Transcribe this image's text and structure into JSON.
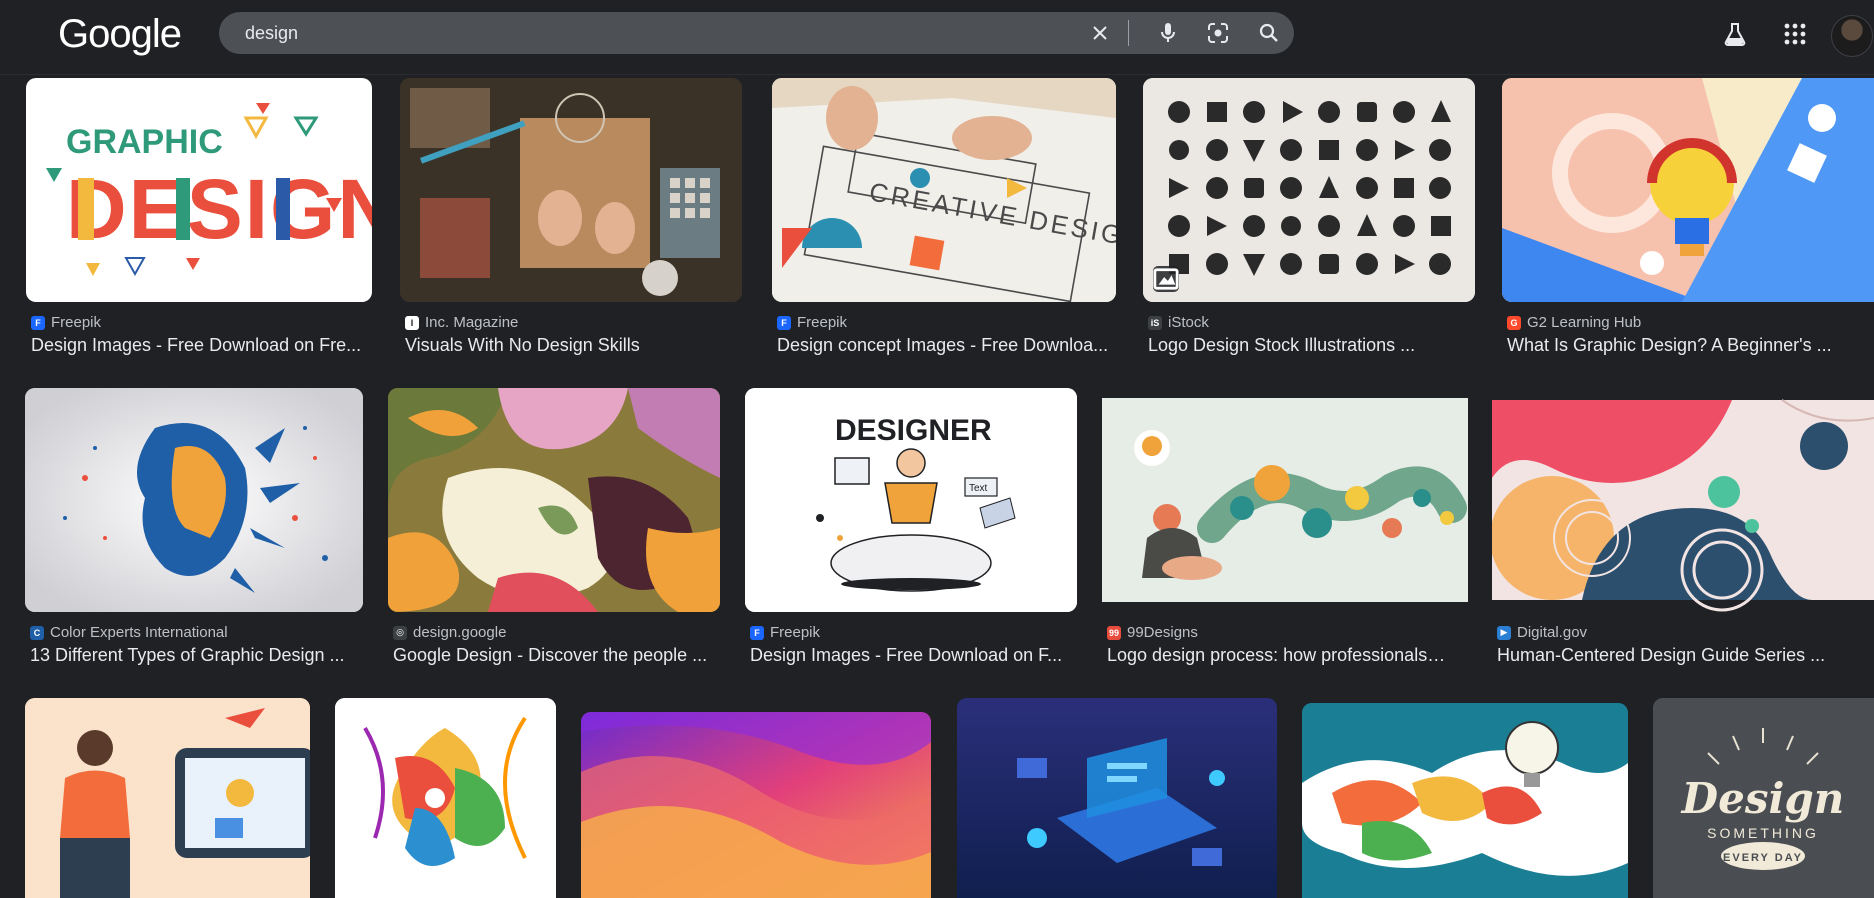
{
  "header": {
    "logo": "Google",
    "search_value": "design",
    "icons": [
      "clear-icon",
      "microphone-icon",
      "lens-icon",
      "search-icon",
      "labs-flask-icon",
      "apps-grid-icon"
    ]
  },
  "colors": {
    "background": "#202124",
    "search_box": "#4d5156",
    "text": "#e8eaed",
    "secondary_text": "#bdc1c6"
  },
  "results": [
    {
      "source": "Freepik",
      "title": "Design Images - Free Download on Fre...",
      "favicon_color": "#1b66ff",
      "favicon_glyph": "F"
    },
    {
      "source": "Inc. Magazine",
      "title": "Visuals With No Design Skills",
      "favicon_color": "#ffffff",
      "favicon_glyph": "I"
    },
    {
      "source": "Freepik",
      "title": "Design concept Images - Free Downloa...",
      "favicon_color": "#1b66ff",
      "favicon_glyph": "F"
    },
    {
      "source": "iStock",
      "title": "Logo Design Stock Illustrations ...",
      "favicon_color": "#3c4043",
      "favicon_glyph": "iS"
    },
    {
      "source": "G2 Learning Hub",
      "title": "What Is Graphic Design? A Beginner's ...",
      "favicon_color": "#ff492c",
      "favicon_glyph": "G"
    },
    {
      "source": "Color Experts International",
      "title": "13 Different Types of Graphic Design ...",
      "favicon_color": "#1f5fa8",
      "favicon_glyph": "C"
    },
    {
      "source": "design.google",
      "title": "Google Design - Discover the people ...",
      "favicon_color": "#3c4043",
      "favicon_glyph": "◎"
    },
    {
      "source": "Freepik",
      "title": "Design Images - Free Download on F...",
      "favicon_color": "#1b66ff",
      "favicon_glyph": "F"
    },
    {
      "source": "99Designs",
      "title": "Logo design process: how professionals ...",
      "favicon_color": "#e94b3c",
      "favicon_glyph": "99"
    },
    {
      "source": "Digital.gov",
      "title": "Human-Centered Design Guide Series ...",
      "favicon_color": "#2a7fd4",
      "favicon_glyph": "▶"
    }
  ]
}
